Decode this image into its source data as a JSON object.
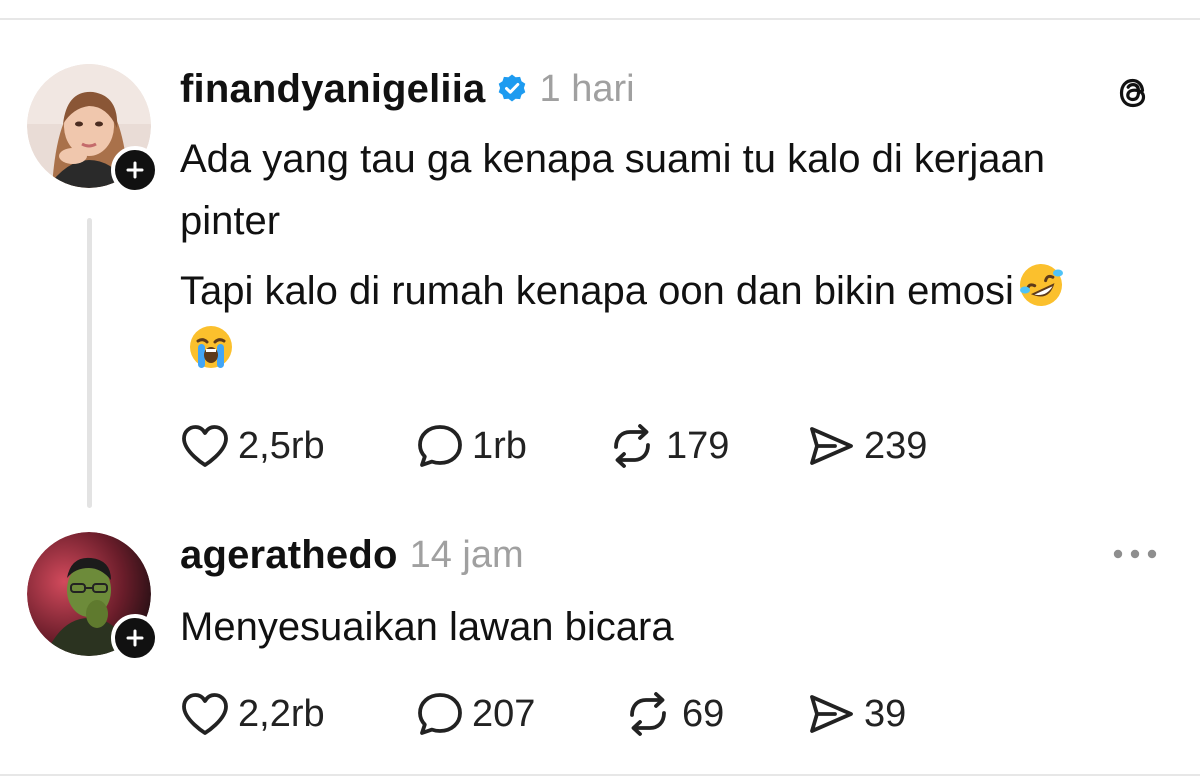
{
  "posts": [
    {
      "username": "finandyanigeliia",
      "verified": true,
      "time": "1 hari",
      "text_lines": [
        "Ada yang tau ga kenapa suami tu kalo di kerjaan pinter",
        "Tapi kalo di rumah kenapa oon dan bikin emosi"
      ],
      "emojis": [
        "rolling-on-floor-laughing",
        "loudly-crying-face"
      ],
      "stats": {
        "likes": "2,5rb",
        "replies": "1rb",
        "reposts": "179",
        "shares": "239"
      },
      "corner_icon": "threads-logo-icon"
    },
    {
      "username": "agerathedo",
      "verified": false,
      "time": "14 jam",
      "text_lines": [
        "Menyesuaikan lawan bicara"
      ],
      "stats": {
        "likes": "2,2rb",
        "replies": "207",
        "reposts": "69",
        "shares": "39"
      },
      "corner_icon": "more-icon"
    }
  ],
  "colors": {
    "text": "#111111",
    "muted": "#a0a0a0",
    "verified": "#1d9bf0",
    "divider": "#e7e7e7"
  }
}
